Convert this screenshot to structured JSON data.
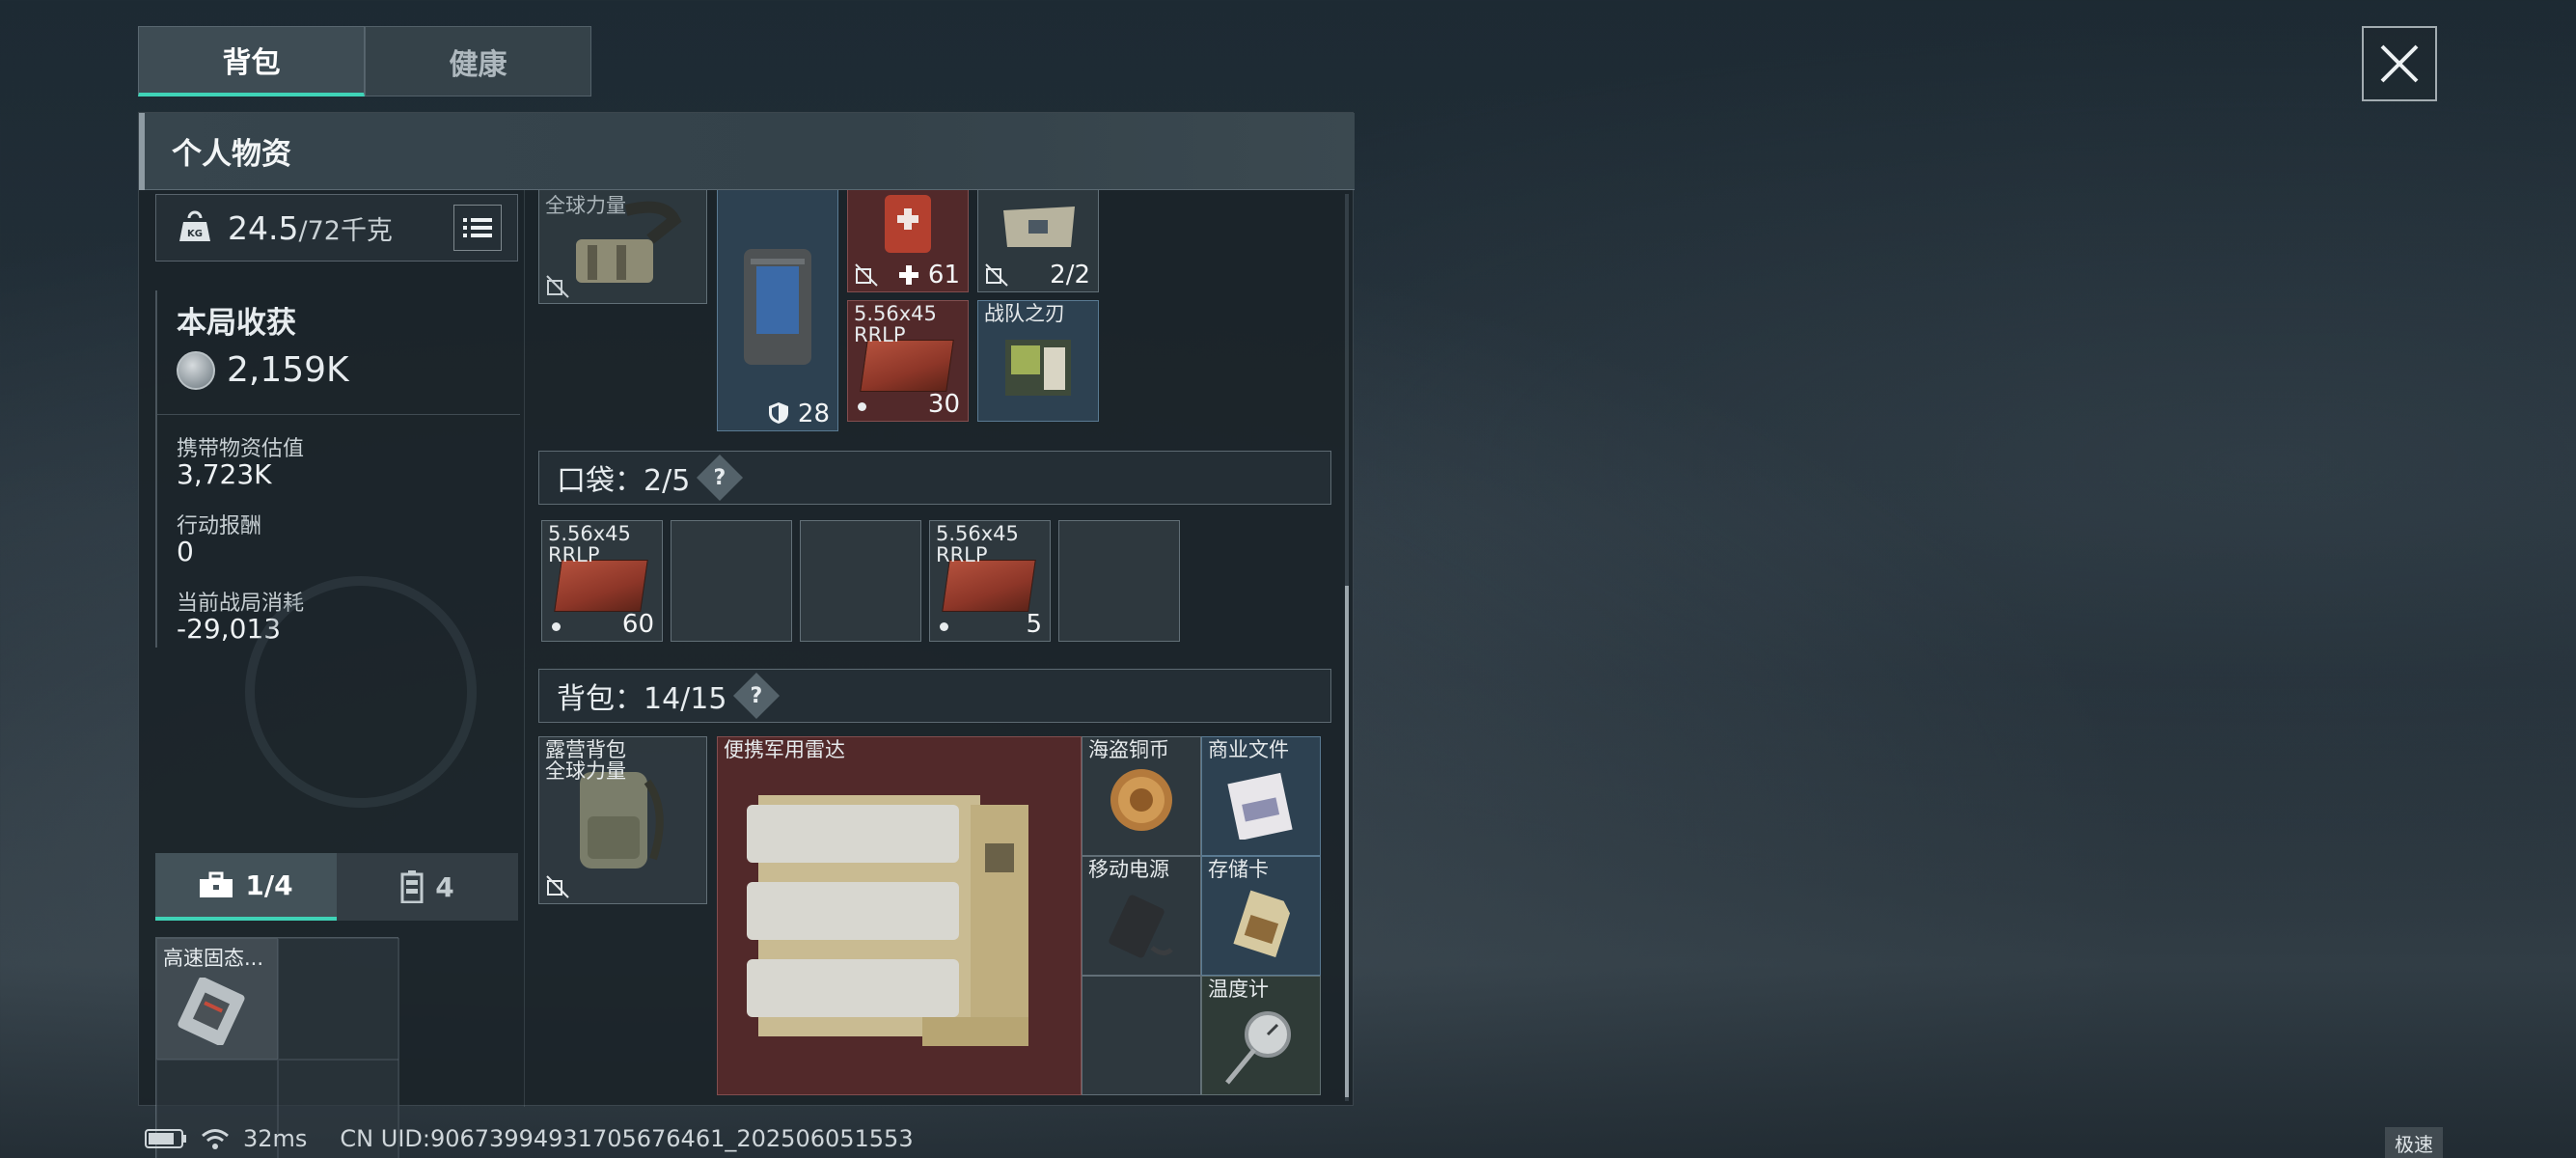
{
  "tabs": [
    {
      "label": "背包",
      "active": true
    },
    {
      "label": "健康",
      "active": false
    }
  ],
  "panel": {
    "title": "个人物资"
  },
  "weight": {
    "current": "24.5",
    "max": "/72千克"
  },
  "harvest": {
    "title": "本局收获",
    "total": "2,159K",
    "stats": [
      {
        "label": "携带物资估值",
        "value": "3,723K"
      },
      {
        "label": "行动报酬",
        "value": "0"
      },
      {
        "label": "当前战局消耗",
        "value": "-29,013"
      }
    ]
  },
  "sub_tabs": [
    {
      "label": "1/4",
      "icon": "briefcase-icon",
      "active": true
    },
    {
      "label": "4",
      "icon": "battery-icon",
      "active": false
    }
  ],
  "case_items": [
    {
      "name": "高速固态..."
    }
  ],
  "gear_items": [
    {
      "name": "全球力量",
      "count": ""
    },
    {
      "name": "",
      "count": "28"
    },
    {
      "name": "",
      "count": "61"
    },
    {
      "name": "",
      "count": "2/2"
    },
    {
      "name": "5.56x45 RRLP",
      "count": "30"
    },
    {
      "name": "战队之刃",
      "count": ""
    }
  ],
  "pocket": {
    "label": "口袋：",
    "count": "2/5",
    "help": "?",
    "items": [
      {
        "name": "5.56x45 RRLP",
        "count": "60"
      },
      {
        "name": "",
        "count": ""
      },
      {
        "name": "",
        "count": ""
      },
      {
        "name": "5.56x45 RRLP",
        "count": "5"
      },
      {
        "name": "",
        "count": ""
      }
    ]
  },
  "backpack": {
    "label": "背包：",
    "count": "14/15",
    "help": "?",
    "items": [
      {
        "name": "露营背包 全球力量"
      },
      {
        "name": "便携军用雷达"
      },
      {
        "name": "海盗铜币"
      },
      {
        "name": "商业文件"
      },
      {
        "name": "移动电源"
      },
      {
        "name": "存储卡"
      },
      {
        "name": "温度计"
      }
    ]
  },
  "status": {
    "ping": "32ms",
    "uid": "CN UID:9067399493170567646­1_202506051553",
    "speed": "极速"
  },
  "colors": {
    "accent": "#3fd3b7",
    "panel_bg": "#1b2329",
    "red_slot": "#5c2a2a",
    "blue_slot": "#30465a"
  }
}
